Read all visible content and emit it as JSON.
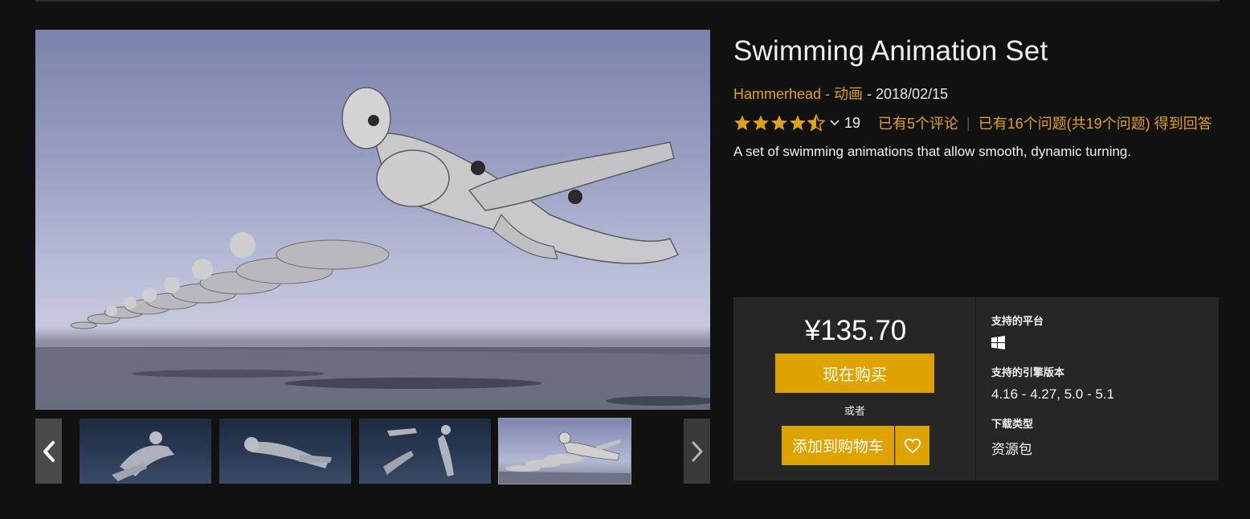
{
  "product": {
    "title": "Swimming Animation Set",
    "seller": "Hammerhead",
    "category": "动画",
    "date": "2018/02/15",
    "rating_stars": 4.5,
    "rating_count": "19",
    "reviews_link": "已有5个评论",
    "questions_link": "已有16个问题(共19个问题) 得到回答",
    "description": "A set of swimming animations that allow smooth, dynamic turning."
  },
  "separators": {
    "dash": " - "
  },
  "purchase": {
    "price": "¥135.70",
    "buy_now": "现在购买",
    "or": "或者",
    "add_to_cart": "添加到购物车"
  },
  "specs": {
    "platforms_label": "支持的平台",
    "platform_icon": "windows-icon",
    "engine_label": "支持的引擎版本",
    "engine_versions": "4.16 - 4.27, 5.0 - 5.1",
    "download_label": "下载类型",
    "download_type": "资源包"
  },
  "gallery": {
    "thumbnail_count": 4,
    "selected_index": 3
  },
  "colors": {
    "accent": "#dfa300",
    "link": "#e0a21a",
    "background": "#111111",
    "panel": "#262626"
  }
}
